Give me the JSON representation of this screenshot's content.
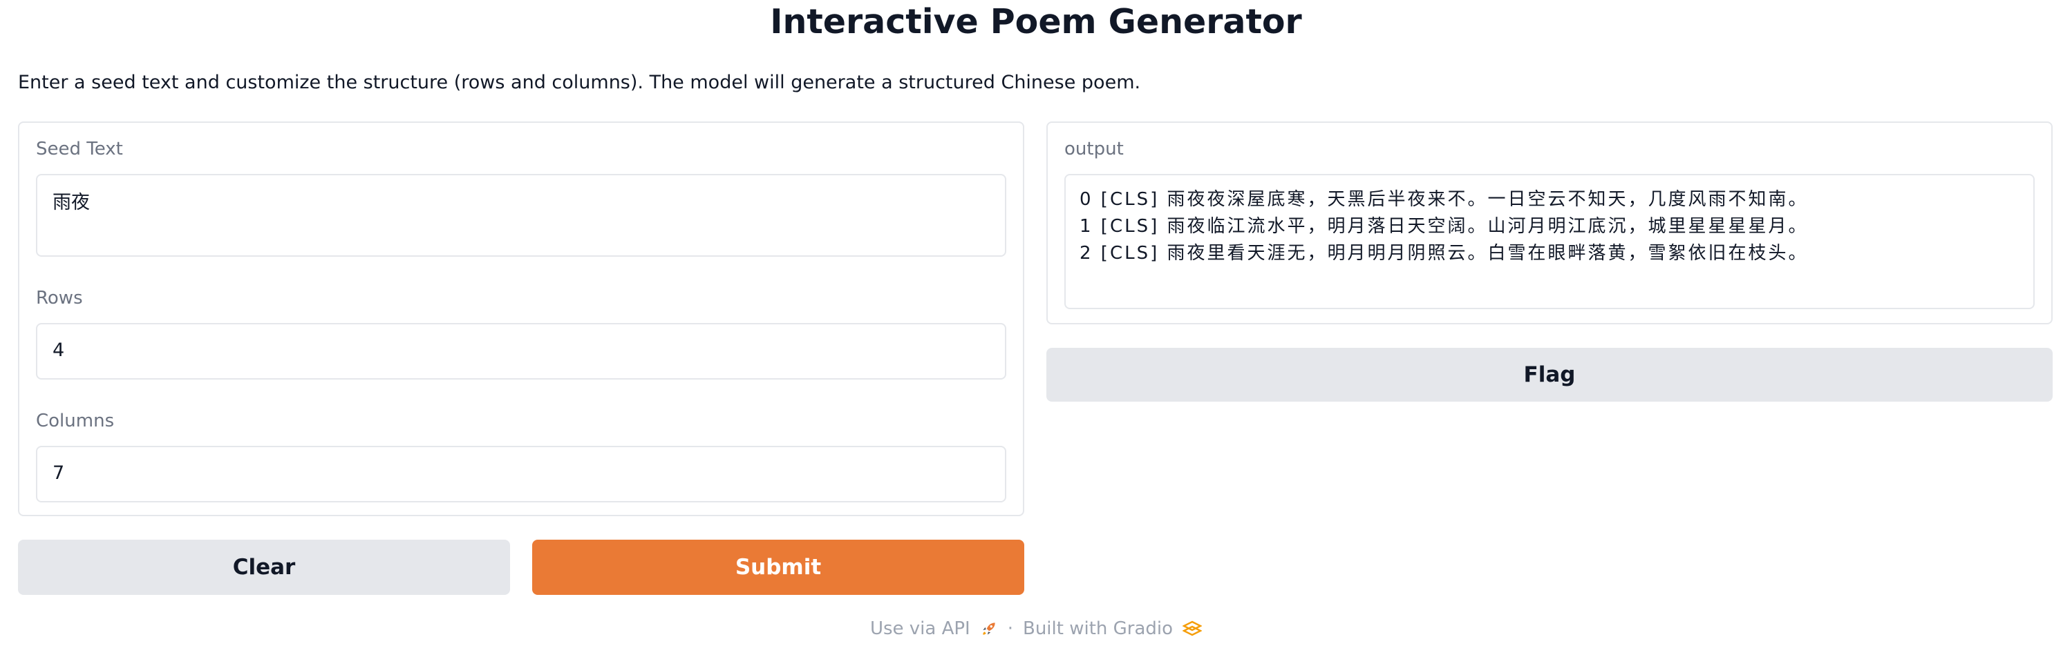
{
  "header": {
    "title": "Interactive Poem Generator",
    "description": "Enter a seed text and customize the structure (rows and columns). The model will generate a structured Chinese poem."
  },
  "inputs": {
    "seed_text": {
      "label": "Seed Text",
      "value": "雨夜"
    },
    "rows": {
      "label": "Rows",
      "value": "4"
    },
    "columns": {
      "label": "Columns",
      "value": "7"
    }
  },
  "output": {
    "label": "output",
    "text": "0 [CLS] 雨夜夜深屋底寒，天黑后半夜来不。一日空云不知天，几度风雨不知南。\n1 [CLS] 雨夜临江流水平，明月落日天空阔。山河月明江底沉，城里星星星星月。\n2 [CLS] 雨夜里看天涯无，明月明月阴照云。白雪在眼畔落黄，雪絮依旧在枝头。"
  },
  "buttons": {
    "clear": "Clear",
    "submit": "Submit",
    "flag": "Flag"
  },
  "footer": {
    "api_link": "Use via API",
    "separator": "·",
    "built_with": "Built with Gradio",
    "icons": [
      "rocket-icon",
      "gradio-logo-icon"
    ]
  },
  "colors": {
    "primary": "#ea7a35",
    "secondary": "#e5e7eb"
  }
}
